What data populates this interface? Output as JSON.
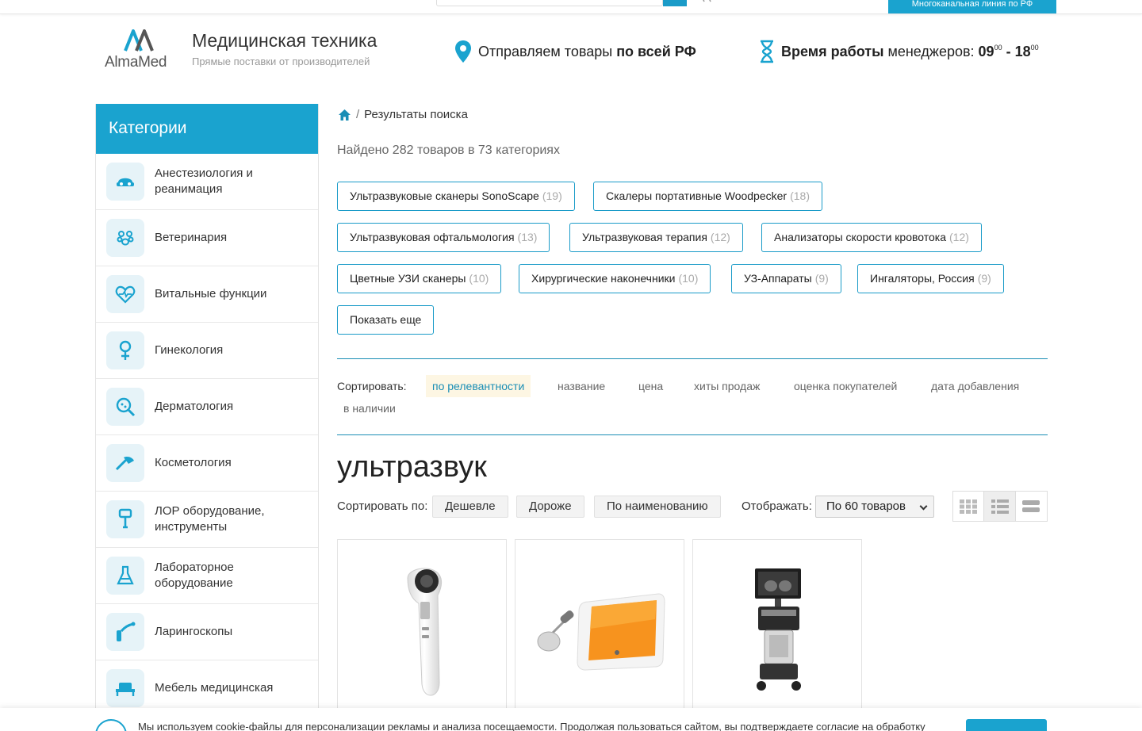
{
  "topbar": {
    "line_label": "Многоканальная линия по РФ"
  },
  "header": {
    "logo_text": "AlmaMed",
    "title": "Медицинская техника",
    "subtitle": "Прямые поставки от производителей",
    "shipping_prefix": "Отправляем товары ",
    "shipping_bold": "по всей РФ",
    "hours_bold": "Время работы",
    "hours_text": " менеджеров: ",
    "hours_from": "09",
    "hours_from_sup": "00",
    "hours_dash": " - ",
    "hours_to": "18",
    "hours_to_sup": "00"
  },
  "sidebar": {
    "title": "Категории",
    "items": [
      {
        "label": "Анестезиология и реанимация",
        "icon": "anesthesia-mask-icon"
      },
      {
        "label": "Ветеринария",
        "icon": "paw-icon"
      },
      {
        "label": "Витальные функции",
        "icon": "heart-pulse-icon"
      },
      {
        "label": "Гинекология",
        "icon": "female-symbol-icon"
      },
      {
        "label": "Дерматология",
        "icon": "magnifier-icon"
      },
      {
        "label": "Косметология",
        "icon": "cosmetology-tool-icon"
      },
      {
        "label": "ЛОР оборудование, инструменты",
        "icon": "ent-instrument-icon"
      },
      {
        "label": "Лабораторное оборудование",
        "icon": "flask-icon"
      },
      {
        "label": "Ларингоскопы",
        "icon": "laryngoscope-icon"
      },
      {
        "label": "Мебель медицинская",
        "icon": "medical-bed-icon"
      }
    ]
  },
  "breadcrumb": {
    "current": "Результаты поиска"
  },
  "results": {
    "found": "Найдено 282 товаров в 73 категориях",
    "categories": [
      {
        "label": "Ультразвуковые сканеры SonoScape",
        "count": "(19)"
      },
      {
        "label": "Скалеры портативные Woodpecker",
        "count": "(18)"
      },
      {
        "label": "Ультразвуковая офтальмология",
        "count": "(13)"
      },
      {
        "label": "Ультразвуковая терапия",
        "count": "(12)"
      },
      {
        "label": "Анализаторы скорости кровотока",
        "count": "(12)"
      },
      {
        "label": "Цветные УЗИ сканеры",
        "count": "(10)"
      },
      {
        "label": "Хирургические наконечники",
        "count": "(10)"
      },
      {
        "label": "УЗ-Аппараты",
        "count": "(9)"
      },
      {
        "label": "Ингаляторы, Россия",
        "count": "(9)"
      }
    ],
    "show_more": "Показать еще"
  },
  "sort": {
    "label": "Сортировать:",
    "options": [
      "по релевантности",
      "название",
      "цена",
      "хиты продаж",
      "оценка покупателей",
      "дата добавления",
      "в наличии"
    ],
    "active": "по релевантности"
  },
  "listing": {
    "heading": "ультразвук",
    "sortby_label": "Сортировать по:",
    "sort_buttons": [
      "Дешевле",
      "Дороже",
      "По наименованию"
    ],
    "show_label": "Отображать:",
    "per_page": "По 60 товаров",
    "views": [
      "grid-view-icon",
      "list-view-icon",
      "compact-view-icon"
    ]
  },
  "cookie": {
    "text": "Мы используем cookie-файлы для персонализации рекламы и анализа посещаемости. Продолжая пользоваться сайтом, вы подтверждаете согласие на обработку"
  },
  "colors": {
    "accent": "#1aa3cf",
    "border_accent": "#1a9bc8",
    "active_sort_bg": "#fdf6e3"
  }
}
